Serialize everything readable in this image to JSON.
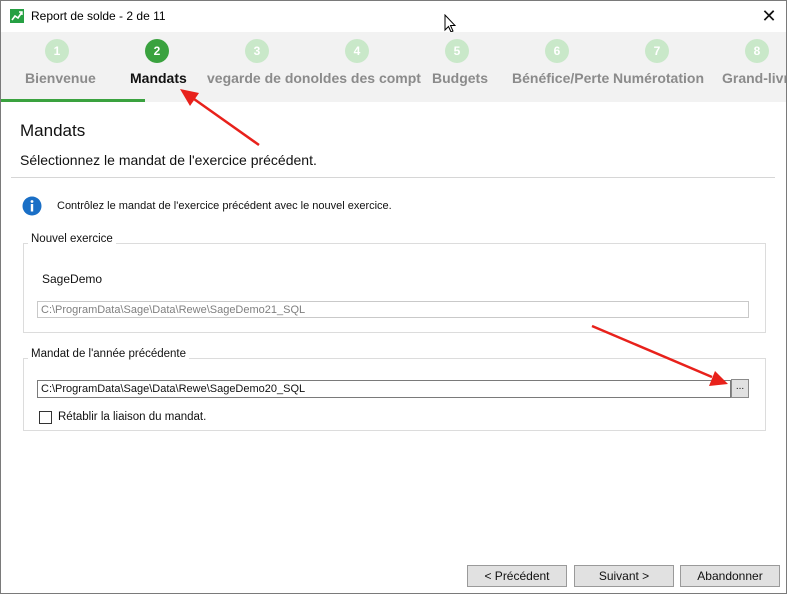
{
  "window": {
    "title": "Report de solde - 2 de 11",
    "close_label": "✕"
  },
  "wizard": {
    "steps": [
      {
        "number": "1",
        "label": "Bienvenue"
      },
      {
        "number": "2",
        "label": "Mandats"
      },
      {
        "number": "3",
        "label": "vegarde de donoldes des compt"
      },
      {
        "number": "4",
        "label": ""
      },
      {
        "number": "5",
        "label": "Budgets"
      },
      {
        "number": "6",
        "label": "Bénéfice/Perte"
      },
      {
        "number": "7",
        "label": "Numérotation"
      },
      {
        "number": "8",
        "label": "Grand-livr"
      }
    ],
    "active_step": 2
  },
  "page": {
    "title": "Mandats",
    "subtitle": "Sélectionnez le mandat de l'exercice précédent."
  },
  "info": {
    "text": "Contrôlez le mandat de l'exercice précédent avec le nouvel exercice."
  },
  "new_exercise": {
    "group_label": "Nouvel exercice",
    "mandate_name": "SageDemo",
    "path": "C:\\ProgramData\\Sage\\Data\\Rewe\\SageDemo21_SQL"
  },
  "previous_year": {
    "group_label": "Mandat de l'année précédente",
    "path": "C:\\ProgramData\\Sage\\Data\\Rewe\\SageDemo20_SQL",
    "browse_label": "...",
    "relink_label": "Rétablir la liaison du mandat.",
    "relink_checked": false
  },
  "buttons": {
    "previous": "< Précédent",
    "next": "Suivant >",
    "cancel": "Abandonner"
  },
  "colors": {
    "accent": "#3aa23f",
    "step_inactive": "#c9e8c9",
    "annotation_arrow": "#e8211b",
    "info_icon": "#1a6fc6"
  }
}
